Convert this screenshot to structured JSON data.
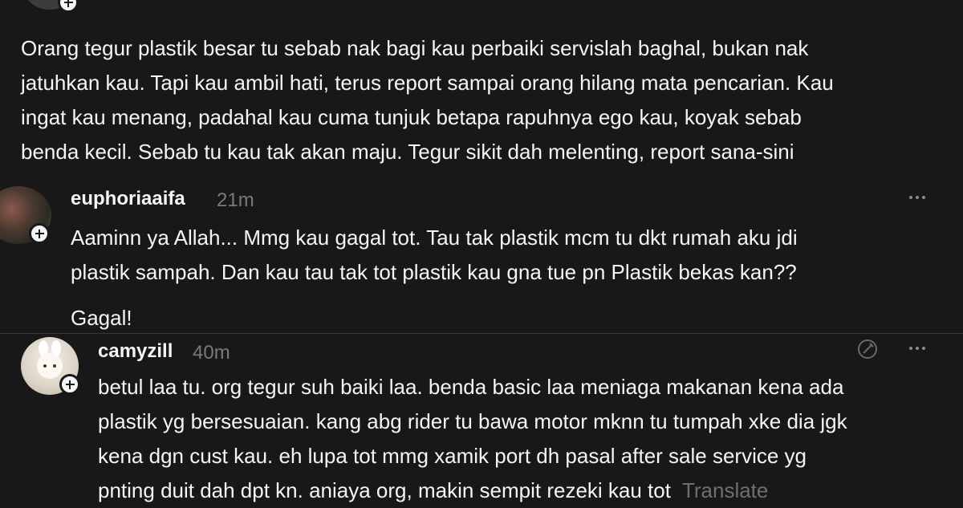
{
  "parent_post": {
    "text": "Orang tegur plastik besar tu sebab nak bagi kau perbaiki servislah baghal, bukan nak\njatuhkan kau. Tapi kau ambil hati, terus report sampai orang hilang mata pencarian. Kau\ningat kau menang, padahal kau cuma tunjuk betapa rapuhnya ego kau, koyak sebab\nbenda kecil. Sebab tu kau tak akan maju. Tegur sikit dah melenting, report sana-sini"
  },
  "reply_1": {
    "username": "euphoriaaifa",
    "time": "21m",
    "text": "Aaminn ya Allah... Mmg kau gagal tot. Tau tak plastik mcm tu dkt rumah aku jdi\nplastik sampah. Dan kau tau tak tot plastik kau gna tue pn Plastik bekas kan??",
    "text_2": "Gagal!",
    "more_icon": "more-horizontal-icon"
  },
  "reply_2": {
    "username": "camyzill",
    "time": "40m",
    "text": "betul laa tu. org tegur suh baiki laa. benda basic laa meniaga makanan kena ada\nplastik yg bersesuaian. kang abg rider tu bawa motor mknn tu tumpah xke dia jgk\nkena dgn cust kau. eh lupa tot mmg xamik port dh pasal after sale service yg\npnting duit dah dpt kn. aniaya org, makin sempit rezeki kau tot",
    "translate_label": "Translate",
    "edit_icon": "edit-off-icon",
    "more_icon": "more-horizontal-icon"
  },
  "colors": {
    "background": "#181818",
    "text": "#f3f5f7",
    "secondary": "#7a7a7a",
    "divider": "#3a3a3a"
  }
}
